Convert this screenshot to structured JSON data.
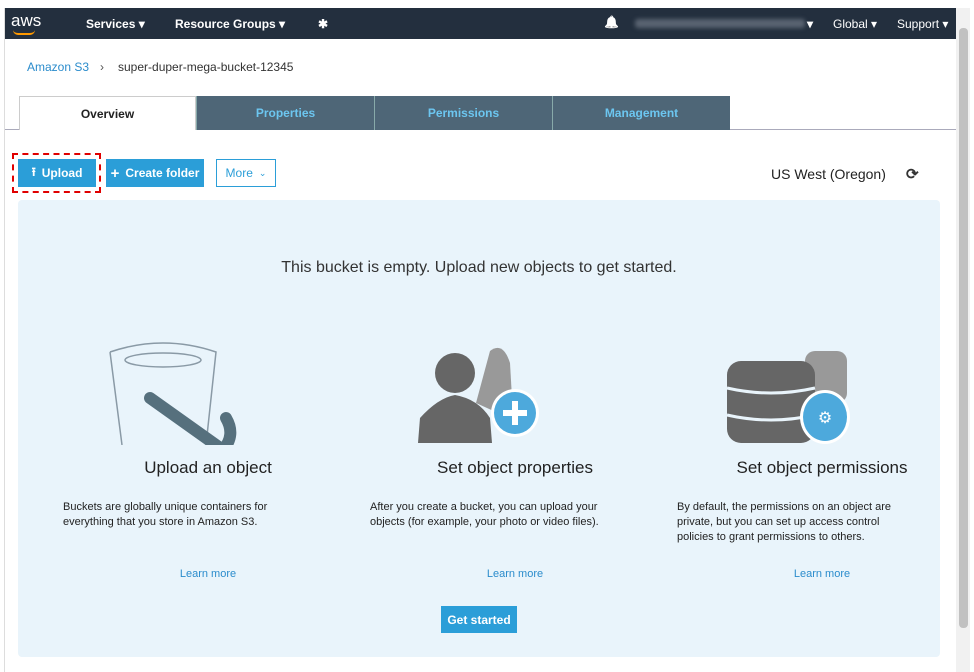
{
  "nav": {
    "logo": "aws",
    "services": "Services ▾",
    "resource_groups": "Resource Groups ▾",
    "pin": "✱",
    "bell": "🔔",
    "account_caret": "▾",
    "region": "Global ▾",
    "support": "Support ▾"
  },
  "breadcrumb": {
    "root": "Amazon S3",
    "sep": "›",
    "current": "super-duper-mega-bucket-12345"
  },
  "tabs": [
    "Overview",
    "Properties",
    "Permissions",
    "Management"
  ],
  "toolbar": {
    "upload": "Upload",
    "create_folder": "Create folder",
    "more": "More",
    "region": "US West (Oregon)"
  },
  "empty": {
    "message": "This bucket is empty. Upload new objects to get started.",
    "get_started": "Get started",
    "cards": [
      {
        "title": "Upload an object",
        "text": "Buckets are globally unique containers for everything that you store in Amazon S3.",
        "link": "Learn more"
      },
      {
        "title": "Set object properties",
        "text": "After you create a bucket, you can upload your objects (for example, your photo or video files).",
        "link": "Learn more"
      },
      {
        "title": "Set object permissions",
        "text": "By default, the permissions on an object are private, but you can set up access control policies to grant permissions to others.",
        "link": "Learn more"
      }
    ]
  },
  "colors": {
    "nav": "#232f3e",
    "accent": "#2b9ed8",
    "tab": "#4e6677",
    "highlight": "#e00000"
  }
}
